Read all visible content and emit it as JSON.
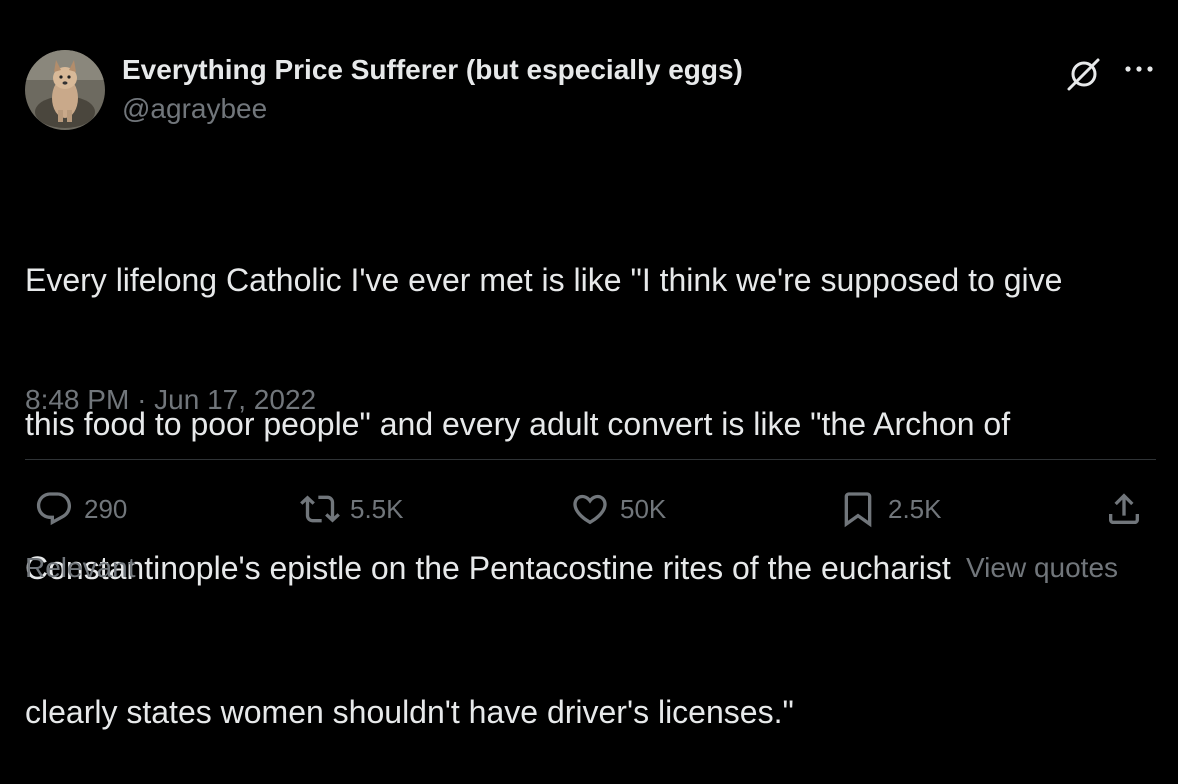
{
  "author": {
    "display_name": "Everything Price Sufferer (but especially eggs)",
    "handle": "@agraybee",
    "avatar_icon": "avatar-photo"
  },
  "header_icons": {
    "grok": "grok-icon",
    "more": "more-icon"
  },
  "tweet": {
    "text_lines": [
      "Every lifelong Catholic I've ever met is like \"I think we're supposed to give",
      "this food to poor people\" and every adult convert is like \"the Archon of",
      "Constantinople's epistle on the Pentacostine rites of the eucharist",
      "clearly states women shouldn't have driver's licenses.\""
    ],
    "time": "8:48 PM",
    "separator": "·",
    "date": "Jun 17, 2022"
  },
  "actions": {
    "replies": "290",
    "retweets": "5.5K",
    "likes": "50K",
    "bookmarks": "2.5K"
  },
  "footer": {
    "sort_label": "Relevant",
    "view_quotes": "View quotes"
  },
  "colors": {
    "background": "#000000",
    "text_primary": "#e7e9ea",
    "text_secondary": "#71767b",
    "divider": "#2f3336"
  }
}
